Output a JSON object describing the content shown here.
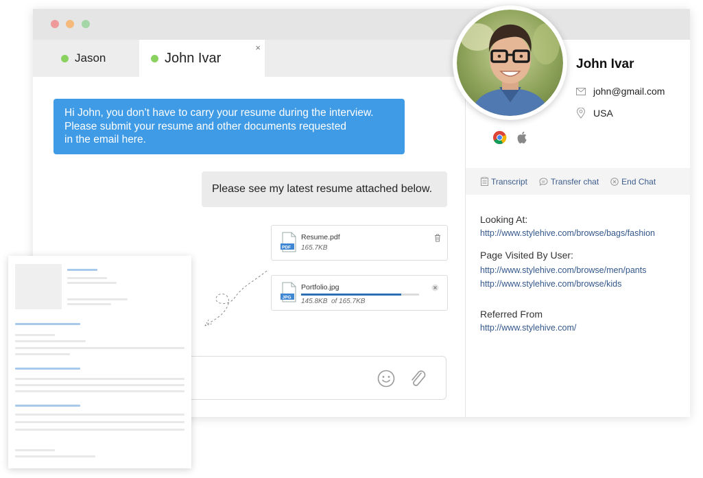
{
  "tabs": [
    {
      "name": "Jason"
    },
    {
      "name": "John Ivar",
      "close": "×"
    }
  ],
  "messages": {
    "incoming": [
      "Hi John, you don’t have to carry your resume during the interview.",
      "Please submit your resume and other documents requested",
      "in the email here."
    ],
    "outgoing": "Please see my latest resume attached below."
  },
  "files": [
    {
      "name": "Resume.pdf",
      "type": "PDF",
      "size": "165.7KB"
    },
    {
      "name": "Portfolio.jpg",
      "type": "JPG",
      "uploaded": "145.8KB",
      "total": "of 165.7KB",
      "progress": 0.85
    }
  ],
  "profile": {
    "name": "John Ivar",
    "email": "john@gmail.com",
    "location": "USA",
    "browser_icons": [
      "chrome-icon",
      "apple-icon"
    ]
  },
  "actions": {
    "transcript": "Transcript",
    "transfer": "Transfer chat",
    "end": "End Chat"
  },
  "visitor": {
    "looking_at_label": "Looking At:",
    "looking_at": "http://www.stylehive.com/browse/bags/fashion",
    "visited_label": "Page Visited By User:",
    "visited": [
      "http://www.stylehive.com/browse/men/pants",
      "http://www.stylehive.com/browse/kids"
    ],
    "referred_label": "Referred From",
    "referred": "http://www.stylehive.com/"
  },
  "colors": {
    "accent": "#3f9be6",
    "online": "#8bd160",
    "link": "#34578c",
    "progress": "#2c6fb4"
  }
}
